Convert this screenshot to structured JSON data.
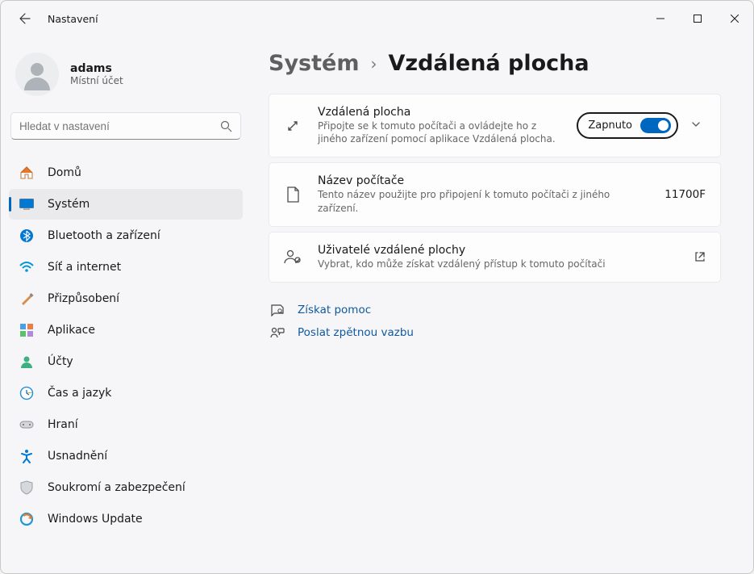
{
  "window": {
    "title": "Nastavení"
  },
  "account": {
    "name": "adams",
    "type": "Místní účet"
  },
  "search": {
    "placeholder": "Hledat v nastavení"
  },
  "nav": {
    "home": "Domů",
    "system": "Systém",
    "bluetooth": "Bluetooth a zařízení",
    "network": "Síť a internet",
    "personalization": "Přizpůsobení",
    "apps": "Aplikace",
    "accounts": "Účty",
    "time": "Čas a jazyk",
    "gaming": "Hraní",
    "accessibility": "Usnadnění",
    "privacy": "Soukromí a zabezpečení",
    "update": "Windows Update"
  },
  "breadcrumb": {
    "root": "Systém",
    "current": "Vzdálená plocha"
  },
  "cards": {
    "remote": {
      "title": "Vzdálená plocha",
      "sub": "Připojte se k tomuto počítači a ovládejte ho z jiného zařízení pomocí aplikace Vzdálená plocha.",
      "toggle_label": "Zapnuto"
    },
    "pcname": {
      "title": "Název počítače",
      "sub": "Tento název použijte pro připojení k tomuto počítači z jiného zařízení.",
      "value": "11700F"
    },
    "users": {
      "title": "Uživatelé vzdálené plochy",
      "sub": "Vybrat, kdo může získat vzdálený přístup k tomuto počítači"
    }
  },
  "links": {
    "help": "Získat pomoc",
    "feedback": "Poslat zpětnou vazbu"
  }
}
